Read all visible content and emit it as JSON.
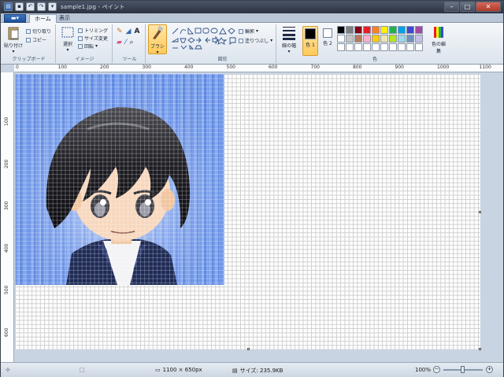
{
  "window": {
    "title": "sample1.jpg - ペイント"
  },
  "tabs": {
    "home": "ホーム",
    "view": "表示"
  },
  "clipboard": {
    "paste": "貼り付け",
    "cut": "切り取り",
    "copy": "コピー",
    "group": "クリップボード"
  },
  "image": {
    "select": "選択",
    "crop": "トリミング",
    "resize": "サイズ変更",
    "rotate": "回転",
    "group": "イメージ"
  },
  "tools": {
    "group": "ツール"
  },
  "brushes": {
    "label": "ブラシ"
  },
  "shapes": {
    "outline": "輪郭",
    "fill": "塗りつぶし",
    "group": "図形"
  },
  "size": {
    "label": "線の幅"
  },
  "colors": {
    "color1": "色 1",
    "color2": "色 2",
    "edit": "色の編集",
    "group": "色",
    "palette": [
      "#000000",
      "#7f7f7f",
      "#880015",
      "#ed1c24",
      "#ff7f27",
      "#fff200",
      "#22b14c",
      "#00a2e8",
      "#3f48cc",
      "#a349a4",
      "#ffffff",
      "#c3c3c3",
      "#b97a57",
      "#ffaec9",
      "#ffc90e",
      "#efe4b0",
      "#b5e61d",
      "#99d9ea",
      "#7092be",
      "#c8bfe7",
      "#ffffff",
      "#ffffff",
      "#ffffff",
      "#ffffff",
      "#ffffff",
      "#ffffff",
      "#ffffff",
      "#ffffff",
      "#ffffff",
      "#ffffff"
    ],
    "primary": "#000000",
    "secondary": "#ffffff"
  },
  "ruler": {
    "h": [
      "0",
      "100",
      "200",
      "300",
      "400",
      "500",
      "600",
      "700",
      "800",
      "900",
      "1000",
      "1100"
    ],
    "v": [
      "100",
      "200",
      "300",
      "400",
      "500",
      "600"
    ]
  },
  "status": {
    "dimensions": "1100 × 650px",
    "size": "サイズ: 235.9KB",
    "zoom": "100%"
  }
}
